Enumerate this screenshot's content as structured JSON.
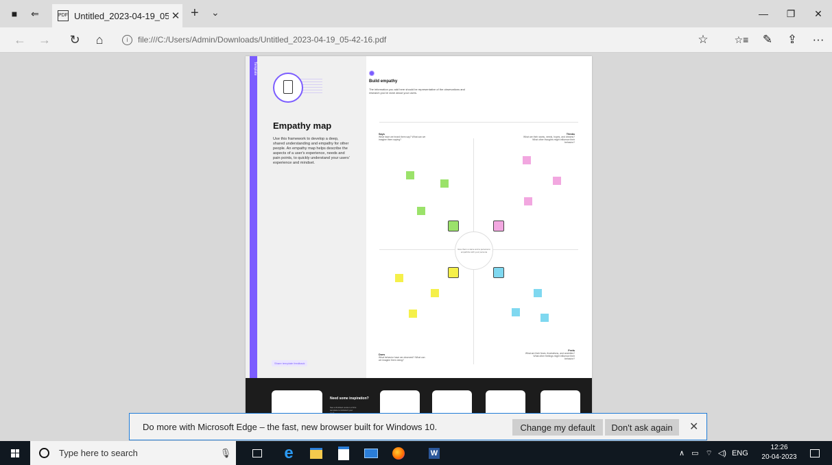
{
  "browser": {
    "tab_title": "Untitled_2023-04-19_05",
    "tab_close": "✕",
    "new_tab": "+",
    "tab_menu": "⌄",
    "url": "file:///C:/Users/Admin/Downloads/Untitled_2023-04-19_05-42-16.pdf",
    "window_controls": {
      "minimize": "—",
      "restore": "❐",
      "close": "✕"
    },
    "nav": {
      "back": "←",
      "forward": "→",
      "refresh": "↻",
      "home": "⌂"
    },
    "toolbar": {
      "favorite": "☆",
      "favorites": "☆≡",
      "notes": "✎",
      "share": "⇪",
      "more": "···"
    }
  },
  "pdf": {
    "side_label": "Template",
    "left_title": "Empathy map",
    "left_body": "Use this framework to develop a deep, shared understanding and empathy for other people. An empathy map helps describe the aspects of a user's experience, needs and pain points, to quickly understand your users' experience and mindset.",
    "feedback": "Share template feedback",
    "right_title": "Build empathy",
    "right_sub": "The information you add here should be representative of the observations and research you've done about your users.",
    "quadrants": {
      "says": {
        "title": "Says",
        "body": "What have we heard them say? What can we imagine them saying?"
      },
      "thinks": {
        "title": "Thinks",
        "body": "What are their wants, needs, hopes, and dreams? What other thoughts might influence their behavior?"
      },
      "does": {
        "title": "Does",
        "body": "What behavior have we observed? What can we imagine them doing?"
      },
      "feels": {
        "title": "Feels",
        "body": "What are their fears, frustrations, and anxieties? What other feelings might influence their behavior?"
      }
    },
    "center_text": "Give them a name and a persona to empathize with your persona",
    "bottom_title": "Need some inspiration?",
    "bottom_body": "See a finished version of this template to kickstart your work."
  },
  "notification": {
    "message": "Do more with Microsoft Edge – the fast, new browser built for Windows 10.",
    "change_default": "Change my default",
    "dont_ask": "Don't ask again",
    "close": "✕"
  },
  "taskbar": {
    "search_placeholder": "Type here to search",
    "language": "ENG",
    "time": "12:26",
    "date": "20-04-2023",
    "tray_chevron": "∧"
  },
  "colors": {
    "accent_purple": "#7b5cff",
    "edge_blue": "#1e7bd7",
    "sticky_green": "#9be26a",
    "sticky_pink": "#f2a7e0",
    "sticky_yellow": "#f5f04a",
    "sticky_cyan": "#7fd8f0"
  }
}
